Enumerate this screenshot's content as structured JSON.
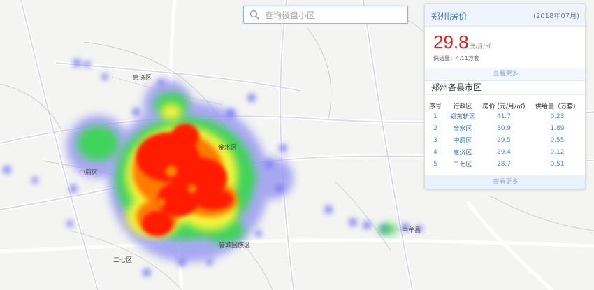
{
  "search": {
    "placeholder": "查询楼盘小区"
  },
  "map": {
    "labels": [
      "惠济区",
      "金水区",
      "中原区",
      "管城回族区",
      "二七区",
      "中牟县"
    ]
  },
  "panel": {
    "title": "郑州房价",
    "date": "(2018年07月)",
    "price": "29.8",
    "price_unit": "元/月/㎡",
    "supply": "供给量：4.11万套",
    "more_top": "查看更多",
    "section_title": "郑州各县市区",
    "table": {
      "headers": [
        "序号",
        "行政区",
        "房价 (元/月/㎡)",
        "供给量（万套）"
      ],
      "rows": [
        [
          "1",
          "郑东新区",
          "41.7",
          "0.23"
        ],
        [
          "2",
          "金水区",
          "30.9",
          "1.89"
        ],
        [
          "3",
          "中原区",
          "29.5",
          "0.55"
        ],
        [
          "4",
          "惠济区",
          "29.4",
          "0.12"
        ],
        [
          "5",
          "二七区",
          "28.7",
          "0.51"
        ]
      ]
    },
    "more_bottom": "查看更多"
  },
  "colors": {
    "accent": "#3f7cc2",
    "price": "#e2231a",
    "heat_high": "#ff0000",
    "heat_mid": "#ffff00",
    "heat_low": "#00cc66",
    "heat_edge": "#8888ff"
  }
}
